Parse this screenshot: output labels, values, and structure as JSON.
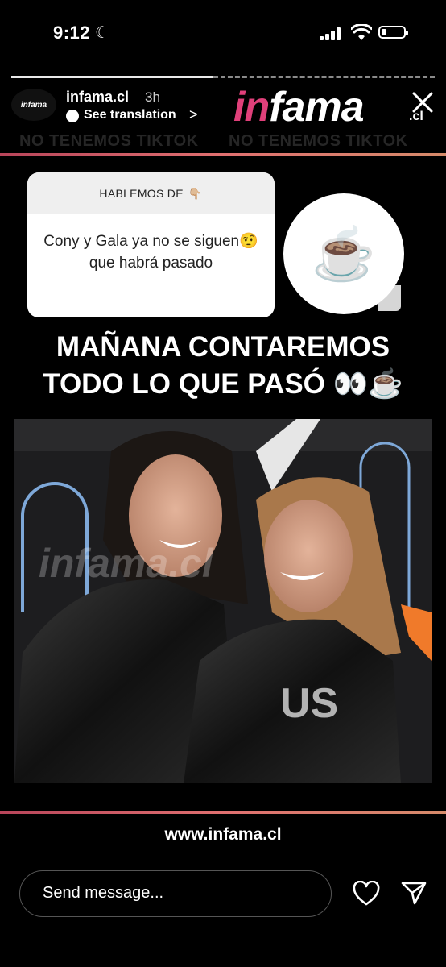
{
  "status_bar": {
    "time": "9:12"
  },
  "story": {
    "username": "infama.cl",
    "time_ago": "3h",
    "translate_label": "See translation",
    "chevron": ">",
    "avatar_text": "infama",
    "brand": {
      "part1": "in",
      "part2": "fama",
      "suffix": ".cl"
    },
    "watermark": [
      "NO TENEMOS TIKTOK",
      "NO TENEMOS TIKTOK"
    ],
    "question": {
      "header": "HABLEMOS DE",
      "header_emoji": "👇🏼",
      "body": "Cony y Gala ya no se siguen🤨 que habrá pasado"
    },
    "coffee_emoji": "☕",
    "headline_line1": "MAÑANA CONTAREMOS",
    "headline_line2": "TODO LO QUE PASÓ 👀☕",
    "photo_watermark": "infama.cl",
    "site_url": "www.infama.cl"
  },
  "bottom_bar": {
    "message_placeholder": "Send message..."
  },
  "colors": {
    "brand_pink": "#e0407a",
    "accent_line": "#e07070"
  }
}
